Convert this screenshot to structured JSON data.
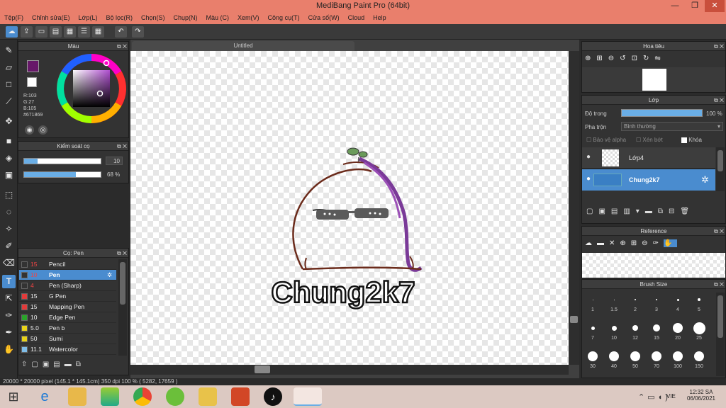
{
  "window": {
    "title": "MediBang Paint Pro (64bit)",
    "min": "—",
    "max": "❐",
    "close": "✕"
  },
  "menu": [
    "Tệp(F)",
    "Chỉnh sửa(E)",
    "Lớp(L)",
    "Bộ lọc(R)",
    "Chọn(S)",
    "Chụp(N)",
    "Màu (C)",
    "Xem(V)",
    "Công cụ(T)",
    "Cửa số(W)",
    "Cloud",
    "Help"
  ],
  "color_panel": {
    "title": "Màu",
    "r": "R:103",
    "g": "G:27",
    "b": "B:105",
    "hex": "#671869",
    "fg": "#671869"
  },
  "brush_ctrl": {
    "title": "Kiểm soát cọ",
    "size": "10",
    "opacity": "68 %",
    "size_fraction": 0.18,
    "opacity_fraction": 0.68
  },
  "brush_panel": {
    "title": "Cọ: Pen",
    "items": [
      {
        "size": "15",
        "name": "Pencil",
        "color": "#333333"
      },
      {
        "size": "10",
        "name": "Pen",
        "color": "#333333",
        "selected": true
      },
      {
        "size": "4",
        "name": "Pen (Sharp)",
        "color": "#333333"
      },
      {
        "size": "15",
        "name": "G Pen",
        "color": "#e23b3b"
      },
      {
        "size": "15",
        "name": "Mapping Pen",
        "color": "#e23b3b"
      },
      {
        "size": "10",
        "name": "Edge Pen",
        "color": "#29a329"
      },
      {
        "size": "5.0",
        "name": "Pen b",
        "color": "#e8d21a"
      },
      {
        "size": "50",
        "name": "Sumi",
        "color": "#e8d21a"
      },
      {
        "size": "11.1",
        "name": "Watercolor",
        "color": "#7fbde8"
      }
    ]
  },
  "canvas": {
    "tab": "Untitled",
    "text": "Chung2k7"
  },
  "navigator": {
    "title": "Hoa tiêu"
  },
  "layer_panel": {
    "title": "Lớp",
    "opacity_label": "Độ trong",
    "opacity_value": "100 %",
    "blend_label": "Pha trộn",
    "blend_value": "Bình thường",
    "protect_alpha": "Bảo vệ alpha",
    "clipping": "Xén bớt",
    "lock": "Khóa",
    "layers": [
      {
        "name": "Lớp4"
      },
      {
        "name": "Chung2k7",
        "selected": true
      }
    ]
  },
  "reference": {
    "title": "Reference"
  },
  "brush_size": {
    "title": "Brush Size",
    "row1": [
      "1",
      "1.5",
      "2",
      "3",
      "4",
      "5"
    ],
    "row2": [
      "7",
      "10",
      "12",
      "15",
      "20",
      "25"
    ],
    "row3": [
      "30",
      "40",
      "50",
      "70",
      "100",
      "150"
    ]
  },
  "status": {
    "text": "20000 * 20000 pixel   (145.1 * 145.1cm)   350 dpi   100 %   ( 5282, 17659 )"
  },
  "taskbar": {
    "lang": "VIE",
    "time": "12:32 SA",
    "date": "06/06/2021"
  }
}
